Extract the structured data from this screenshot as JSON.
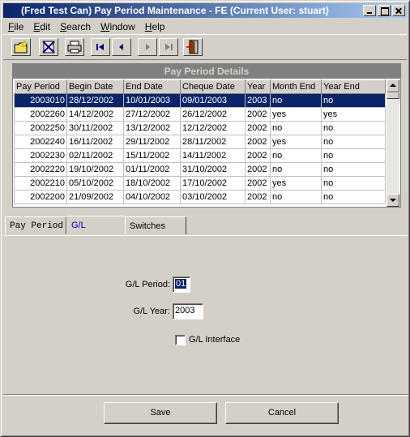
{
  "window": {
    "title": "(Fred Test Can) Pay Period Maintenance - FE (Current User: stuart)"
  },
  "menu": [
    {
      "label": "File",
      "key": "F",
      "rest": "ile"
    },
    {
      "label": "Edit",
      "key": "E",
      "rest": "dit"
    },
    {
      "label": "Search",
      "key": "S",
      "rest": "earch"
    },
    {
      "label": "Window",
      "key": "W",
      "rest": "indow"
    },
    {
      "label": "Help",
      "key": "H",
      "rest": "elp"
    }
  ],
  "toolbar": {
    "icons": [
      "new-folder-icon",
      "delete-icon",
      "print-icon",
      "first-record-icon",
      "previous-record-icon",
      "next-record-icon",
      "last-record-icon",
      "exit-door-icon"
    ]
  },
  "grid": {
    "title": "Pay Period Details",
    "columns": [
      "Pay Period",
      "Begin Date",
      "End Date",
      "Cheque Date",
      "Year",
      "Month End",
      "Year End"
    ],
    "rows": [
      [
        "2003010",
        "28/12/2002",
        "10/01/2003",
        "09/01/2003",
        "2003",
        "no",
        "no"
      ],
      [
        "2002260",
        "14/12/2002",
        "27/12/2002",
        "26/12/2002",
        "2002",
        "yes",
        "yes"
      ],
      [
        "2002250",
        "30/11/2002",
        "13/12/2002",
        "12/12/2002",
        "2002",
        "no",
        "no"
      ],
      [
        "2002240",
        "16/11/2002",
        "29/11/2002",
        "28/11/2002",
        "2002",
        "yes",
        "no"
      ],
      [
        "2002230",
        "02/11/2002",
        "15/11/2002",
        "14/11/2002",
        "2002",
        "no",
        "no"
      ],
      [
        "2002220",
        "19/10/2002",
        "01/11/2002",
        "31/10/2002",
        "2002",
        "no",
        "no"
      ],
      [
        "2002210",
        "05/10/2002",
        "18/10/2002",
        "17/10/2002",
        "2002",
        "yes",
        "no"
      ],
      [
        "2002200",
        "21/09/2002",
        "04/10/2002",
        "03/10/2002",
        "2002",
        "no",
        "no"
      ]
    ],
    "selected_row": 0
  },
  "tabs": [
    {
      "label": "Pay Period"
    },
    {
      "label": "G/L"
    },
    {
      "label": "Switches"
    }
  ],
  "form": {
    "gl_period_label": "G/L Period:",
    "gl_period_value": "01",
    "gl_year_label": "G/L Year:",
    "gl_year_value": "2003",
    "gl_interface_label": "G/L Interface",
    "gl_interface_checked": false
  },
  "buttons": {
    "save": "Save",
    "cancel": "Cancel"
  }
}
